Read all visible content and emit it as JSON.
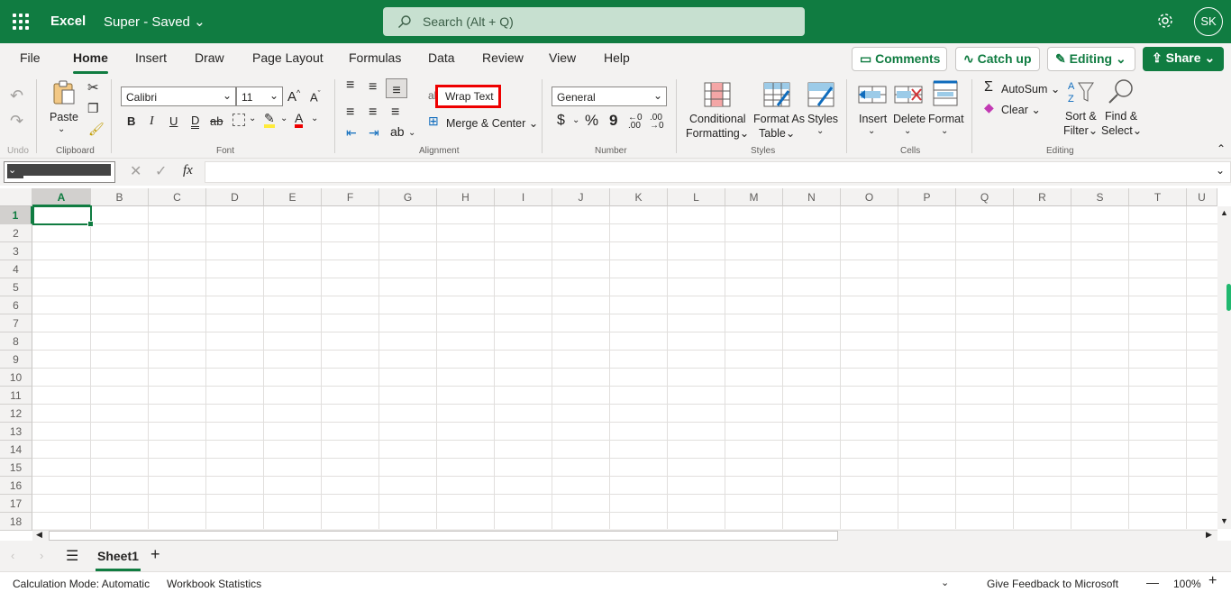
{
  "titlebar": {
    "app_name": "Excel",
    "doc_name": "Super - Saved",
    "search_placeholder": "Search (Alt + Q)",
    "avatar_initials": "SK"
  },
  "tabs": [
    "File",
    "Home",
    "Insert",
    "Draw",
    "Page Layout",
    "Formulas",
    "Data",
    "Review",
    "View",
    "Help"
  ],
  "active_tab": "Home",
  "top_buttons": {
    "comments": "Comments",
    "catch_up": "Catch up",
    "editing": "Editing",
    "share": "Share"
  },
  "ribbon": {
    "undo_group": "Undo",
    "clipboard": {
      "paste": "Paste",
      "group": "Clipboard"
    },
    "font": {
      "name": "Calibri",
      "size": "11",
      "group": "Font",
      "bold": "B",
      "italic": "I",
      "underline": "U",
      "double_underline": "D",
      "strike": "ab"
    },
    "alignment": {
      "wrap_text": "Wrap Text",
      "merge_center": "Merge & Center",
      "group": "Alignment"
    },
    "number": {
      "format": "General",
      "currency": "$",
      "percent": "%",
      "comma": "9",
      "group": "Number"
    },
    "styles": {
      "conditional_1": "Conditional",
      "conditional_2": "Formatting",
      "format_table_1": "Format As",
      "format_table_2": "Table",
      "styles": "Styles",
      "group": "Styles"
    },
    "cells": {
      "insert": "Insert",
      "delete": "Delete",
      "format": "Format",
      "group": "Cells"
    },
    "editing": {
      "autosum": "AutoSum",
      "clear": "Clear",
      "sort_1": "Sort &",
      "sort_2": "Filter",
      "find_1": "Find &",
      "find_2": "Select",
      "group": "Editing"
    }
  },
  "formula_bar": {
    "name_box": "A1",
    "fx": "fx",
    "value": ""
  },
  "grid": {
    "columns": [
      "A",
      "B",
      "C",
      "D",
      "E",
      "F",
      "G",
      "H",
      "I",
      "J",
      "K",
      "L",
      "M",
      "N",
      "O",
      "P",
      "Q",
      "R",
      "S",
      "T",
      "U"
    ],
    "rows": [
      "1",
      "2",
      "3",
      "4",
      "5",
      "6",
      "7",
      "8",
      "9",
      "10",
      "11",
      "12",
      "13",
      "14",
      "15",
      "16",
      "17",
      "18"
    ],
    "selected_cell": "A1"
  },
  "sheets": [
    "Sheet1"
  ],
  "active_sheet": "Sheet1",
  "status": {
    "calc_mode": "Calculation Mode: Automatic",
    "workbook_stats": "Workbook Statistics",
    "feedback": "Give Feedback to Microsoft",
    "zoom": "100%"
  },
  "colors": {
    "brand": "#107c41",
    "highlight": "#e00000"
  }
}
